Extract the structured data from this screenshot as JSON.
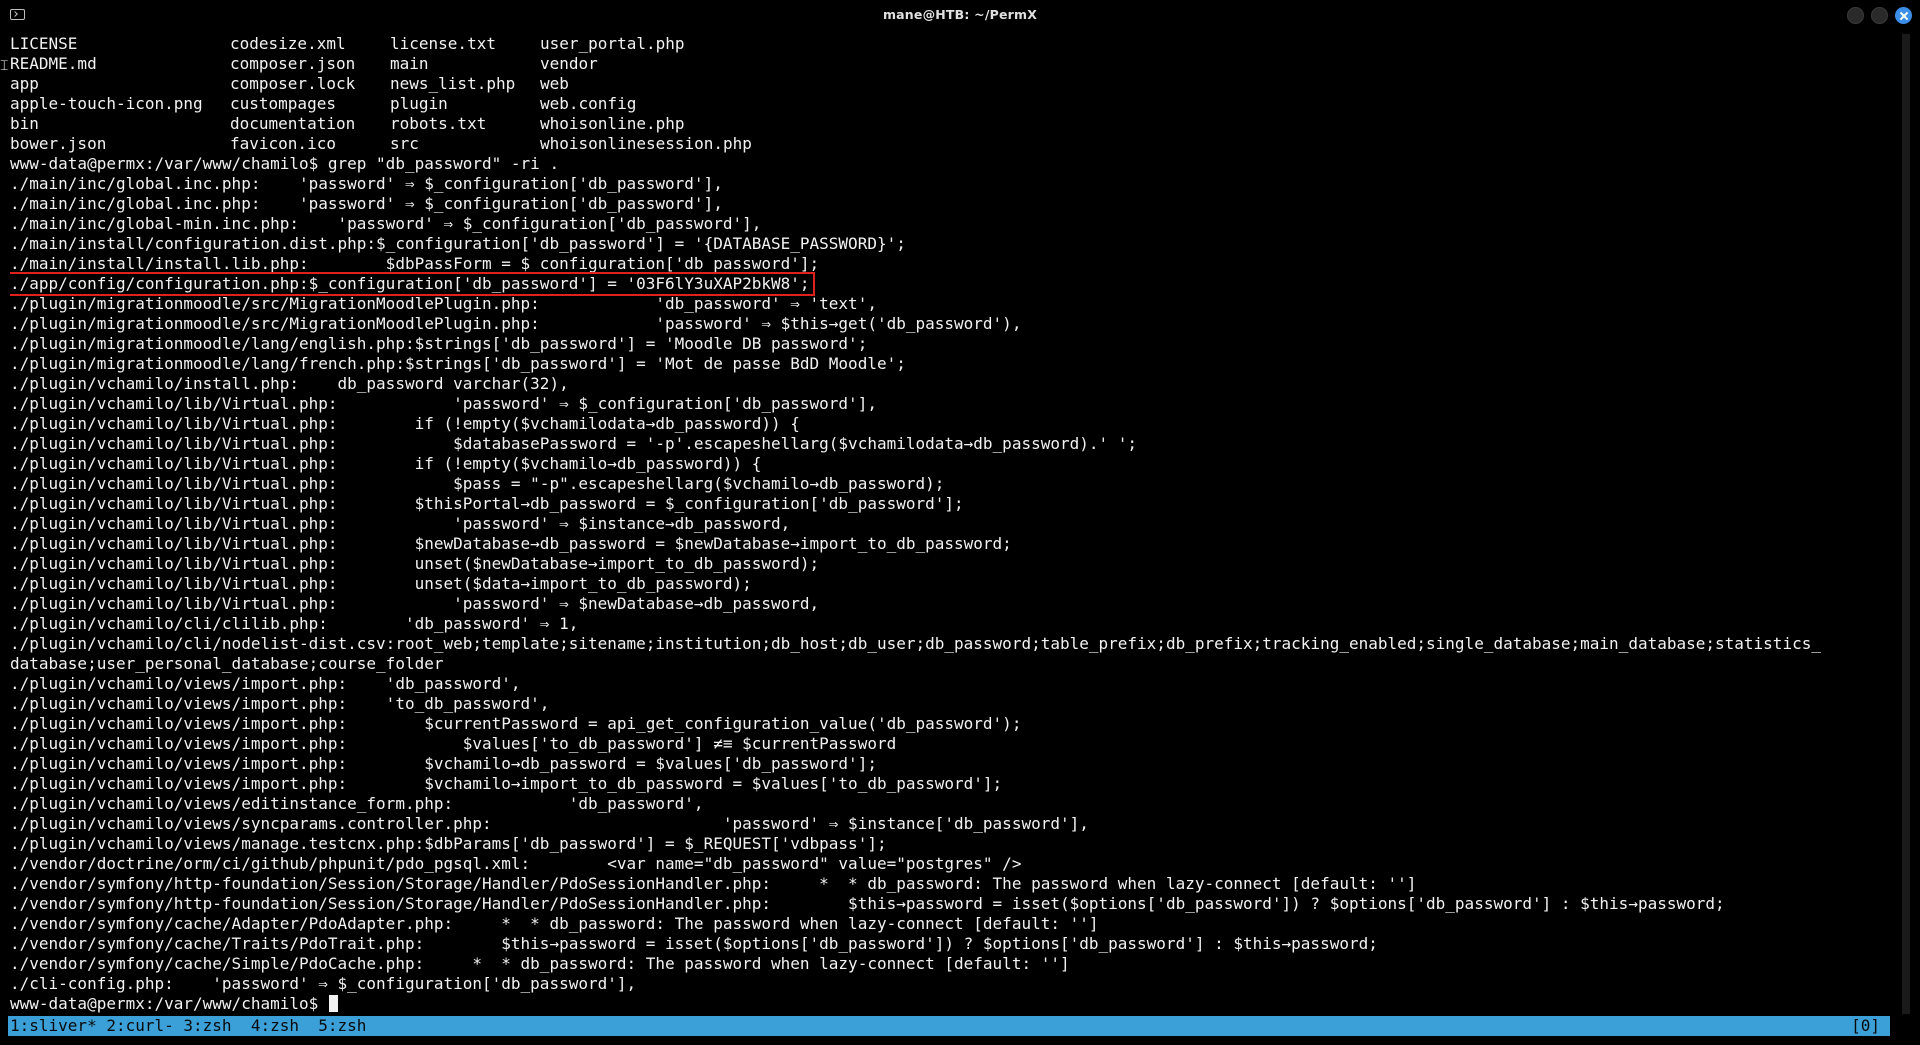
{
  "window": {
    "title": "mane@HTB: ~/PermX"
  },
  "ls_output": [
    [
      "LICENSE",
      "codesize.xml",
      "license.txt",
      "user_portal.php"
    ],
    [
      "README.md",
      "composer.json",
      "main",
      "vendor"
    ],
    [
      "app",
      "composer.lock",
      "news_list.php",
      "web"
    ],
    [
      "apple-touch-icon.png",
      "custompages",
      "plugin",
      "web.config"
    ],
    [
      "bin",
      "documentation",
      "robots.txt",
      "whoisonline.php"
    ],
    [
      "bower.json",
      "favicon.ico",
      "src",
      "whoisonlinesession.php"
    ]
  ],
  "prompt_command": "www-data@permx:/var/www/chamilo$ grep \"db_password\" -ri .",
  "grep_lines_before": [
    "./main/inc/global.inc.php:    'password' ⇒ $_configuration['db_password'],",
    "./main/inc/global.inc.php:    'password' ⇒ $_configuration['db_password'],",
    "./main/inc/global-min.inc.php:    'password' ⇒ $_configuration['db_password'],",
    "./main/install/configuration.dist.php:$_configuration['db_password'] = '{DATABASE_PASSWORD}';",
    "./main/install/install.lib.php:        $dbPassForm = $_configuration['db_password'];"
  ],
  "highlighted_line": "./app/config/configuration.php:$_configuration['db_password'] = '03F6lY3uXAP2bkW8';",
  "grep_lines_after": [
    "./plugin/migrationmoodle/src/MigrationMoodlePlugin.php:            'db_password' ⇒ 'text',",
    "./plugin/migrationmoodle/src/MigrationMoodlePlugin.php:            'password' ⇒ $this→get('db_password'),",
    "./plugin/migrationmoodle/lang/english.php:$strings['db_password'] = 'Moodle DB password';",
    "./plugin/migrationmoodle/lang/french.php:$strings['db_password'] = 'Mot de passe BdD Moodle';",
    "./plugin/vchamilo/install.php:    db_password varchar(32),",
    "./plugin/vchamilo/lib/Virtual.php:            'password' ⇒ $_configuration['db_password'],",
    "./plugin/vchamilo/lib/Virtual.php:        if (!empty($vchamilodata→db_password)) {",
    "./plugin/vchamilo/lib/Virtual.php:            $databasePassword = '-p'.escapeshellarg($vchamilodata→db_password).' ';",
    "./plugin/vchamilo/lib/Virtual.php:        if (!empty($vchamilo→db_password)) {",
    "./plugin/vchamilo/lib/Virtual.php:            $pass = \"-p\".escapeshellarg($vchamilo→db_password);",
    "./plugin/vchamilo/lib/Virtual.php:        $thisPortal→db_password = $_configuration['db_password'];",
    "./plugin/vchamilo/lib/Virtual.php:            'password' ⇒ $instance→db_password,",
    "./plugin/vchamilo/lib/Virtual.php:        $newDatabase→db_password = $newDatabase→import_to_db_password;",
    "./plugin/vchamilo/lib/Virtual.php:        unset($newDatabase→import_to_db_password);",
    "./plugin/vchamilo/lib/Virtual.php:        unset($data→import_to_db_password);",
    "./plugin/vchamilo/lib/Virtual.php:            'password' ⇒ $newDatabase→db_password,",
    "./plugin/vchamilo/cli/clilib.php:        'db_password' ⇒ 1,",
    "./plugin/vchamilo/cli/nodelist-dist.csv:root_web;template;sitename;institution;db_host;db_user;db_password;table_prefix;db_prefix;tracking_enabled;single_database;main_database;statistics_",
    "database;user_personal_database;course_folder",
    "./plugin/vchamilo/views/import.php:    'db_password',",
    "./plugin/vchamilo/views/import.php:    'to_db_password',",
    "./plugin/vchamilo/views/import.php:        $currentPassword = api_get_configuration_value('db_password');",
    "./plugin/vchamilo/views/import.php:            $values['to_db_password'] ≠≡ $currentPassword",
    "./plugin/vchamilo/views/import.php:        $vchamilo→db_password = $values['db_password'];",
    "./plugin/vchamilo/views/import.php:        $vchamilo→import_to_db_password = $values['to_db_password'];",
    "./plugin/vchamilo/views/editinstance_form.php:            'db_password',",
    "./plugin/vchamilo/views/syncparams.controller.php:                        'password' ⇒ $instance['db_password'],",
    "./plugin/vchamilo/views/manage.testcnx.php:$dbParams['db_password'] = $_REQUEST['vdbpass'];",
    "./vendor/doctrine/orm/ci/github/phpunit/pdo_pgsql.xml:        <var name=\"db_password\" value=\"postgres\" />",
    "./vendor/symfony/http-foundation/Session/Storage/Handler/PdoSessionHandler.php:     *  * db_password: The password when lazy-connect [default: '']",
    "./vendor/symfony/http-foundation/Session/Storage/Handler/PdoSessionHandler.php:        $this→password = isset($options['db_password']) ? $options['db_password'] : $this→password;",
    "./vendor/symfony/cache/Adapter/PdoAdapter.php:     *  * db_password: The password when lazy-connect [default: '']",
    "./vendor/symfony/cache/Traits/PdoTrait.php:        $this→password = isset($options['db_password']) ? $options['db_password'] : $this→password;",
    "./vendor/symfony/cache/Simple/PdoCache.php:     *  * db_password: The password when lazy-connect [default: '']",
    "./cli-config.php:    'password' ⇒ $_configuration['db_password'],"
  ],
  "final_prompt": "www-data@permx:/var/www/chamilo$ ",
  "statusbar": {
    "windows": "1:sliver* 2:curl- 3:zsh  4:zsh  5:zsh",
    "right": "[0]"
  },
  "colors": {
    "highlight_box": "#e0201c",
    "statusbar_bg": "#3b9fd8",
    "close_button": "#3b8ee8"
  },
  "icons": {
    "terminal": "terminal-icon",
    "close": "close-icon",
    "mouse": "mouse-cursor-icon"
  }
}
